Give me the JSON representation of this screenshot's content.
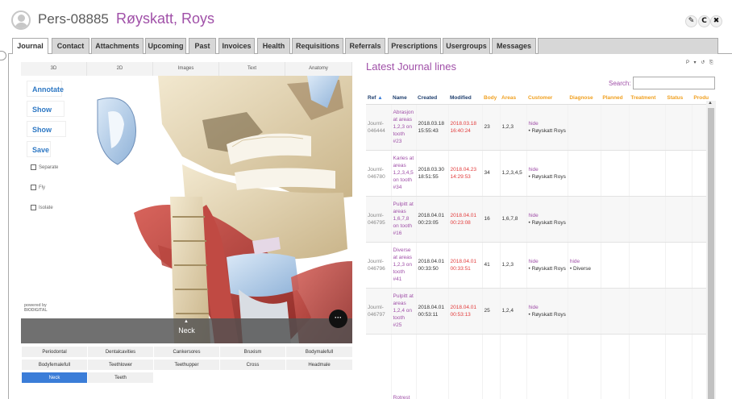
{
  "header": {
    "person_id": "Pers-08885",
    "person_name": "Røyskatt, Roys",
    "buttons": [
      "✎",
      "C",
      "✖"
    ]
  },
  "tabs": [
    {
      "label": "Journal",
      "active": true
    },
    {
      "label": "Contact"
    },
    {
      "label": "Attachments"
    },
    {
      "label": "Upcoming"
    },
    {
      "label": "Past"
    },
    {
      "label": "Invoices"
    },
    {
      "label": "Health"
    },
    {
      "label": "Requisitions"
    },
    {
      "label": "Referrals"
    },
    {
      "label": "Prescriptions"
    },
    {
      "label": "Usergroups"
    },
    {
      "label": "Messages"
    }
  ],
  "viewer": {
    "view_tabs": [
      "3D",
      "2D",
      "Images",
      "Text",
      "Anatomy"
    ],
    "buttons": [
      "Annotate",
      "Show text",
      "Show xray",
      "Save"
    ],
    "checkboxes": [
      "Separate",
      "Fly",
      "Isolate"
    ],
    "brand_line1": "powered by",
    "brand_line2": "BIODIGITAL",
    "region_label": "Neck",
    "up_arrow": "▲",
    "more_label": "···"
  },
  "anatomy_grid": [
    [
      "Periodontal",
      "Dentalcavities",
      "Cankersores",
      "Bruxism",
      "Bodymalefull"
    ],
    [
      "Bodyfemalefull",
      "Teethlower",
      "Teethupper",
      "Cross",
      "Headmale"
    ],
    [
      "Neck",
      "Teeth"
    ]
  ],
  "anatomy_selected": "Neck",
  "journal": {
    "title": "Latest Journal lines",
    "toolbar_icons": "P ▾ ↺ ⎘",
    "search_label": "Search:",
    "search_value": "",
    "columns": [
      "Ref",
      "Name",
      "Created",
      "Modified",
      "Body",
      "Areas",
      "Customer",
      "Diagnose",
      "Planned",
      "Treatment",
      "Status",
      "Produ"
    ],
    "sort_indicator": "▲",
    "rows": [
      {
        "ref": "Journl-046444",
        "name": "Abrasjon at areas 1,2,3 on tooth #23",
        "created": "2018.03.18 15:55:43",
        "modified": "2018.03.18 16:40:24",
        "body": "23",
        "areas": "1,2,3",
        "customer_hide": "hide",
        "customer": "Røyskatt Roys",
        "diagnose_hide": "",
        "diagnose": ""
      },
      {
        "ref": "Journl-046780",
        "name": "Karies at areas 1,2,3,4,5 on tooth #34",
        "created": "2018.03.30 18:51:55",
        "modified": "2018.04.23 14:29:53",
        "body": "34",
        "areas": "1,2,3,4,5",
        "customer_hide": "hide",
        "customer": "Røyskatt Roys",
        "diagnose_hide": "",
        "diagnose": ""
      },
      {
        "ref": "Journl-046795",
        "name": "Pulpitt at areas 1,6,7,8 on tooth #16",
        "created": "2018.04.01 00:23:05",
        "modified": "2018.04.01 00:23:08",
        "body": "16",
        "areas": "1,6,7,8",
        "customer_hide": "hide",
        "customer": "Røyskatt Roys",
        "diagnose_hide": "",
        "diagnose": ""
      },
      {
        "ref": "Journl-046796",
        "name": "Diverse at areas 1,2,3 on tooth #41",
        "created": "2018.04.01 00:33:50",
        "modified": "2018.04.01 00:33:51",
        "body": "41",
        "areas": "1,2,3",
        "customer_hide": "hide",
        "customer": "Røyskatt Roys",
        "diagnose_hide": "hide",
        "diagnose": "Diverse"
      },
      {
        "ref": "Journl-046797",
        "name": "Pulpitt at areas 1,2,4 on tooth #25",
        "created": "2018.04.01 00:53:11",
        "modified": "2018.04.01 00:53:13",
        "body": "25",
        "areas": "1,2,4",
        "customer_hide": "hide",
        "customer": "Røyskatt Roys",
        "diagnose_hide": "",
        "diagnose": ""
      },
      {
        "ref": "",
        "name": "Rotrest",
        "created": "",
        "modified": "",
        "body": "",
        "areas": "",
        "customer_hide": "",
        "customer": "",
        "diagnose_hide": "",
        "diagnose": ""
      }
    ],
    "scroll_arrow": "▲"
  }
}
